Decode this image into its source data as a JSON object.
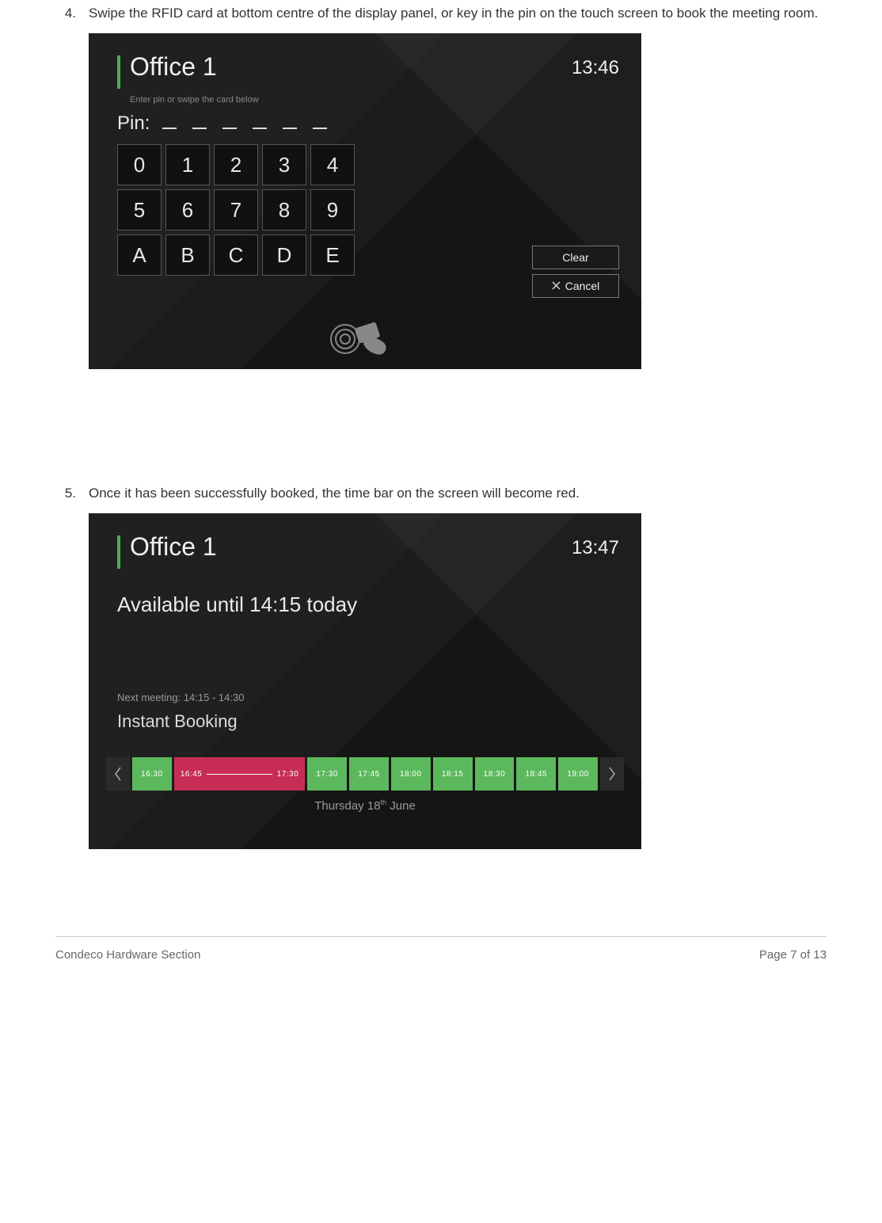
{
  "steps": {
    "s4": {
      "num": "4.",
      "text": "Swipe the RFID card at bottom centre of the display panel, or key in the pin on the touch screen to book the meeting room."
    },
    "s5": {
      "num": "5.",
      "text": "Once it has been successfully booked, the time bar on the screen will become red."
    }
  },
  "screen1": {
    "room": "Office 1",
    "clock": "13:46",
    "hint": "Enter pin or swipe the card below",
    "pinLabel": "Pin:",
    "pinSlots": 6,
    "keys": [
      "0",
      "1",
      "2",
      "3",
      "4",
      "5",
      "6",
      "7",
      "8",
      "9",
      "A",
      "B",
      "C",
      "D",
      "E"
    ],
    "clear": "Clear",
    "cancel": "Cancel"
  },
  "screen2": {
    "room": "Office 1",
    "clock": "13:47",
    "available": "Available until 14:15 today",
    "nextMeeting": "Next meeting: 14:15 - 14:30",
    "instant": "Instant Booking",
    "slots": {
      "pre": "16:30",
      "bookStart": "16:45",
      "bookEnd": "17:30",
      "rest": [
        "17:30",
        "17:45",
        "18:00",
        "18:15",
        "18:30",
        "18:45",
        "19:00"
      ]
    },
    "dateDay": "Thursday 18",
    "dateOrd": "th",
    "dateMonth": " June"
  },
  "footer": {
    "left": "Condeco Hardware Section",
    "right": "Page 7 of 13"
  }
}
